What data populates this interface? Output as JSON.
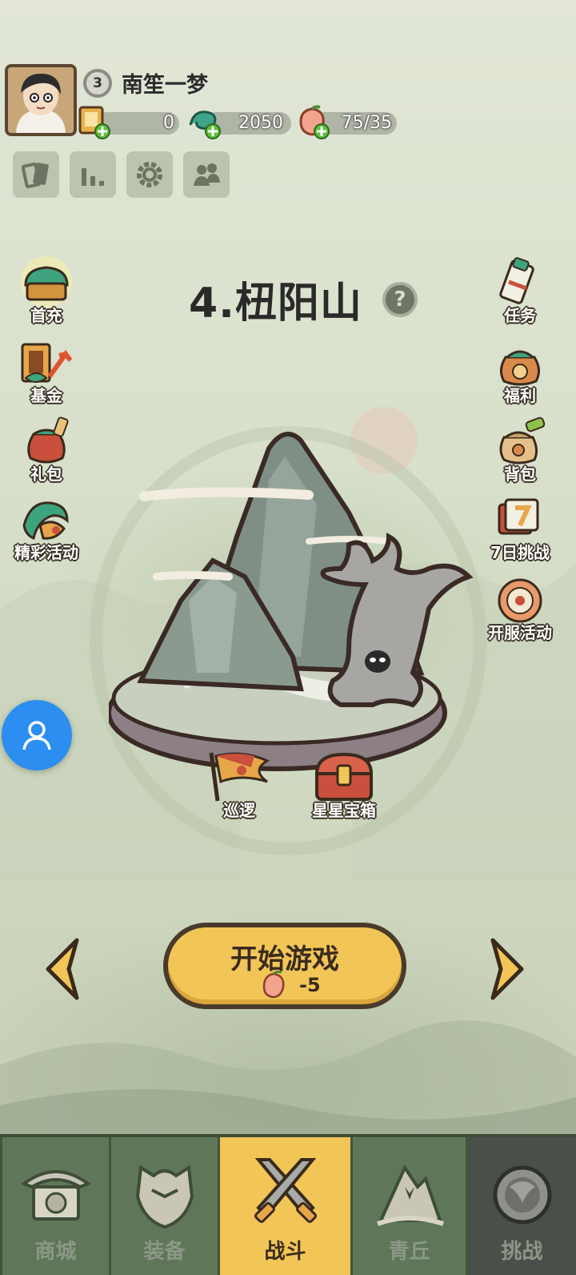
{
  "player": {
    "level": "3",
    "name": "南笙一梦"
  },
  "resources": {
    "scrolls": "0",
    "jade": "2050",
    "stamina": "75/35"
  },
  "stage": {
    "title": "4.杻阳山",
    "help_icon": "question-mark-icon"
  },
  "left_menu": [
    {
      "label": "首充",
      "icon": "first-recharge-chest-icon"
    },
    {
      "label": "基金",
      "icon": "fund-icon"
    },
    {
      "label": "礼包",
      "icon": "gift-bag-icon"
    },
    {
      "label": "精彩活动",
      "icon": "dragon-event-icon"
    }
  ],
  "right_menu": [
    {
      "label": "任务",
      "icon": "scroll-task-icon"
    },
    {
      "label": "福利",
      "icon": "welfare-bag-icon"
    },
    {
      "label": "背包",
      "icon": "backpack-icon"
    },
    {
      "label": "7日挑战",
      "icon": "seven-day-challenge-icon"
    },
    {
      "label": "开服活动",
      "icon": "server-event-icon"
    }
  ],
  "stage_actions": {
    "patrol": "巡逻",
    "star_chest": "星星宝箱"
  },
  "start_button": {
    "label": "开始游戏",
    "cost": "-5"
  },
  "bottom_nav": [
    {
      "label": "商城",
      "icon": "shop-pavilion-icon",
      "active": false
    },
    {
      "label": "装备",
      "icon": "armor-icon",
      "active": false
    },
    {
      "label": "战斗",
      "icon": "crossed-swords-icon",
      "active": true
    },
    {
      "label": "青丘",
      "icon": "mountain-icon",
      "active": false
    },
    {
      "label": "挑战",
      "icon": "challenge-orb-icon",
      "active": false
    }
  ],
  "colors": {
    "background": "#d9e0cc",
    "start_button": "#f1c657",
    "nav_bar": "#5f7758",
    "nav_active": "#f1c657",
    "floating_button": "#2b8ef0"
  }
}
